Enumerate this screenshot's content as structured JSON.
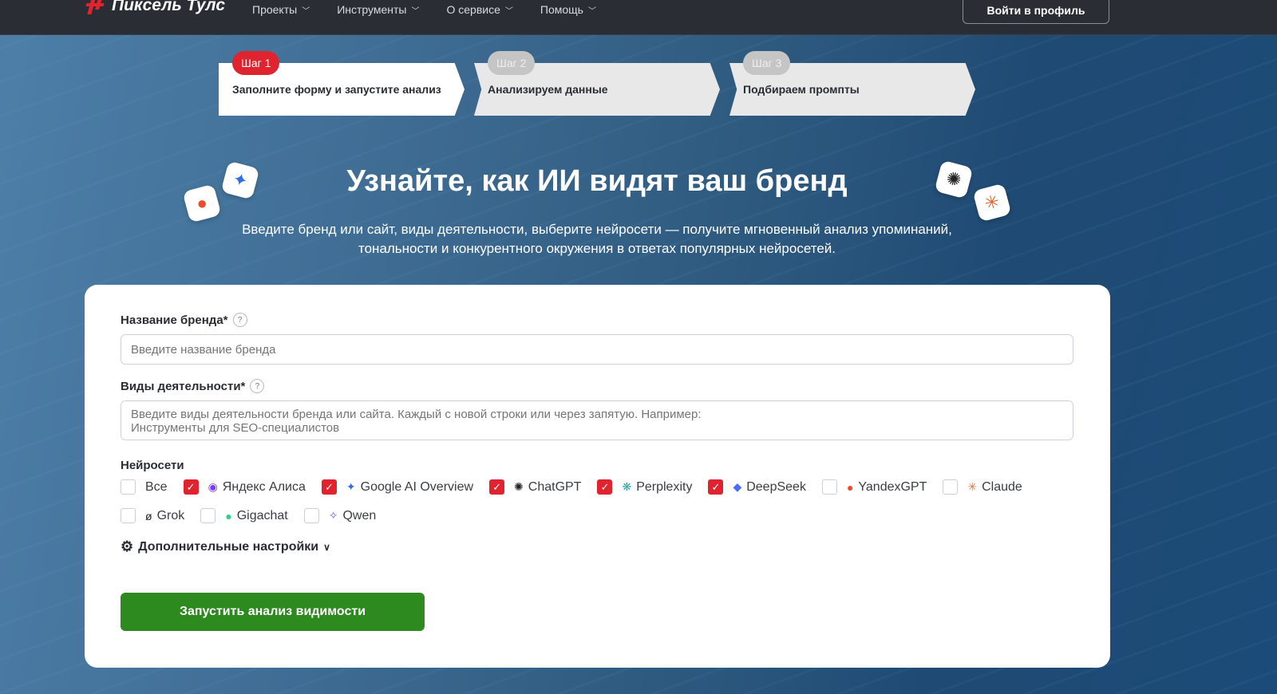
{
  "header": {
    "logo": "Пиксель Тулс",
    "nav": [
      "Проекты",
      "Инструменты",
      "О сервисе",
      "Помощь"
    ],
    "login": "Войти в профиль"
  },
  "steps": [
    {
      "badge": "Шаг 1",
      "title": "Заполните форму и запустите анализ"
    },
    {
      "badge": "Шаг 2",
      "title": "Анализируем данные"
    },
    {
      "badge": "Шаг 3",
      "title": "Подбираем промпты"
    }
  ],
  "hero": {
    "title": "Узнайте, как ИИ видят ваш бренд",
    "subtitle_1": "Введите бренд или сайт, виды деятельности, выберите нейросети — получите мгновенный анализ упоминаний,",
    "subtitle_2": "тональности и конкурентного окружения в ответах популярных нейросетей."
  },
  "form": {
    "brand_label": "Название бренда*",
    "brand_placeholder": "Введите название бренда",
    "activity_label": "Виды деятельности*",
    "activity_placeholder": "Введите виды деятельности бренда или сайта. Каждый с новой строки или через запятую. Например:\nИнструменты для SEO-специалистов",
    "networks_label": "Нейросети",
    "networks": [
      {
        "label": "Все",
        "checked": false,
        "icon": "",
        "color": ""
      },
      {
        "label": "Яндекс Алиса",
        "checked": true,
        "icon": "◉",
        "color": "#7b3cf0"
      },
      {
        "label": "Google AI Overview",
        "checked": true,
        "icon": "✦",
        "color": "#2f6fe8"
      },
      {
        "label": "ChatGPT",
        "checked": true,
        "icon": "✺",
        "color": "#222"
      },
      {
        "label": "Perplexity",
        "checked": true,
        "icon": "❋",
        "color": "#2aa6a6"
      },
      {
        "label": "DeepSeek",
        "checked": true,
        "icon": "◆",
        "color": "#4d6bfe"
      },
      {
        "label": "YandexGPT",
        "checked": false,
        "icon": "●",
        "color": "#f04a2a"
      },
      {
        "label": "Claude",
        "checked": false,
        "icon": "✳",
        "color": "#d9774b"
      },
      {
        "label": "Grok",
        "checked": false,
        "icon": "ø",
        "color": "#222"
      },
      {
        "label": "Gigachat",
        "checked": false,
        "icon": "●",
        "color": "#2fcf8f"
      },
      {
        "label": "Qwen",
        "checked": false,
        "icon": "✧",
        "color": "#7b5cf0"
      }
    ],
    "advanced": "Дополнительные настройки",
    "submit": "Запустить анализ видимости"
  }
}
